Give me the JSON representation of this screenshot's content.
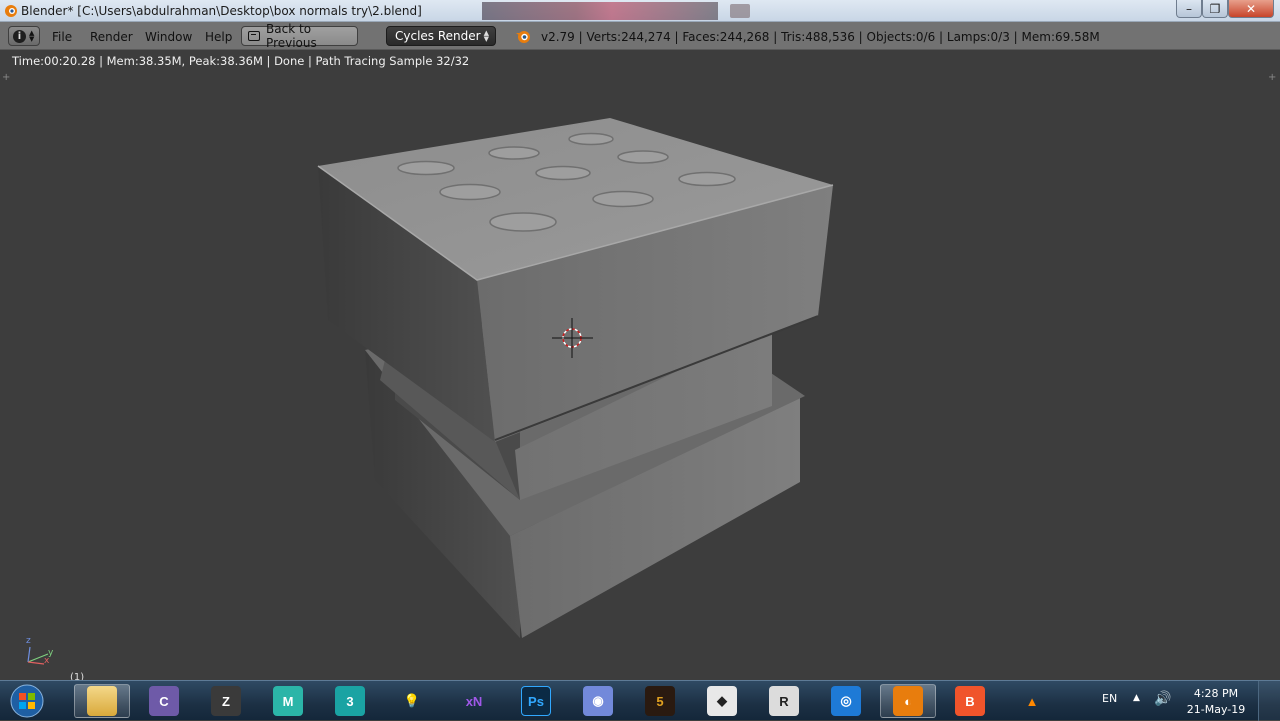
{
  "window": {
    "title": "Blender* [C:\\Users\\abdulrahman\\Desktop\\box normals try\\2.blend]",
    "minimize": "–",
    "maximize": "❐",
    "close": "✕"
  },
  "header": {
    "menu": [
      "File",
      "Render",
      "Window",
      "Help"
    ],
    "back_button": "Back to Previous",
    "render_engine": "Cycles Render",
    "stats": "v2.79 | Verts:244,274 | Faces:244,268 | Tris:488,536 | Objects:0/6 | Lamps:0/3 | Mem:69.58M"
  },
  "viewport": {
    "render_info": "Time:00:20.28 | Mem:38.35M, Peak:38.36M | Done | Path Tracing Sample 32/32",
    "frame": "(1)",
    "axis_labels": {
      "x": "x",
      "y": "y",
      "z": "z"
    }
  },
  "taskbar": {
    "apps": [
      {
        "name": "file-explorer-icon",
        "glyph": "",
        "color": "#e8c15a",
        "active": true
      },
      {
        "name": "cyberlink-icon",
        "glyph": "C",
        "color": "#6e5aa8",
        "active": false
      },
      {
        "name": "zbrush-icon",
        "glyph": "Z",
        "color": "#3a3a3a",
        "active": false
      },
      {
        "name": "maya-icon",
        "glyph": "M",
        "color": "#2bb5a8",
        "active": false
      },
      {
        "name": "3dsmax-icon",
        "glyph": "3",
        "color": "#1aa3a3",
        "active": false
      },
      {
        "name": "lightbulb-icon",
        "glyph": "💡",
        "color": "transparent",
        "active": false
      },
      {
        "name": "xnormal-icon",
        "glyph": "xN",
        "color": "transparent",
        "active": false
      },
      {
        "name": "photoshop-icon",
        "glyph": "Ps",
        "color": "#0b2a45",
        "active": false
      },
      {
        "name": "discord-icon",
        "glyph": "◉",
        "color": "#7289da",
        "active": false
      },
      {
        "name": "game-launcher-icon",
        "glyph": "5",
        "color": "#2a1a10",
        "active": false
      },
      {
        "name": "warframe-icon",
        "glyph": "◆",
        "color": "#e8e8e8",
        "active": false
      },
      {
        "name": "obs-icon",
        "glyph": "R",
        "color": "#dcdcdc",
        "active": false
      },
      {
        "name": "photos-icon",
        "glyph": "◎",
        "color": "#1e7ad6",
        "active": false
      },
      {
        "name": "blender-icon",
        "glyph": "◐",
        "color": "#e87d0d",
        "active": true
      },
      {
        "name": "brave-icon",
        "glyph": "B",
        "color": "#f0542b",
        "active": false
      },
      {
        "name": "vlc-icon",
        "glyph": "▲",
        "color": "transparent",
        "active": false
      }
    ],
    "language": "EN",
    "time": "4:28 PM",
    "date": "21-May-19"
  }
}
